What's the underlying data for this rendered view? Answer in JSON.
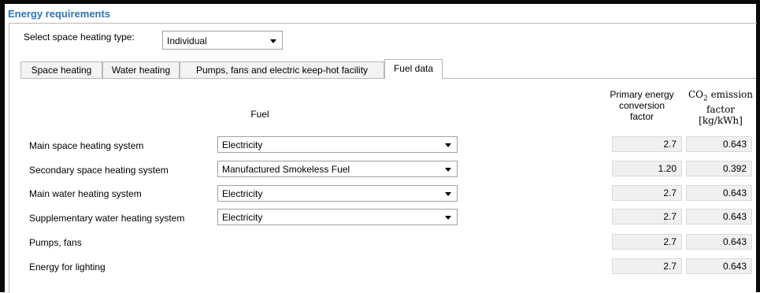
{
  "section_title": "Energy requirements",
  "heating_type": {
    "label": "Select space heating type:",
    "value": "Individual"
  },
  "tabs": [
    {
      "label": "Space heating",
      "active": false
    },
    {
      "label": "Water heating",
      "active": false
    },
    {
      "label": "Pumps, fans and electric keep-hot facility",
      "active": false
    },
    {
      "label": "Fuel data",
      "active": true
    }
  ],
  "table": {
    "fuel_header": "Fuel",
    "pef_header": [
      "Primary energy",
      "conversion",
      "factor"
    ],
    "co2_header": [
      "CO",
      "2",
      " emission",
      "factor",
      "[kg/kWh]"
    ],
    "rows": [
      {
        "label": "Main space heating system",
        "fuel": "Electricity",
        "pef": "2.7",
        "co2": "0.643"
      },
      {
        "label": "Secondary space heating system",
        "fuel": "Manufactured Smokeless Fuel",
        "pef": "1.20",
        "co2": "0.392"
      },
      {
        "label": "Main water heating system",
        "fuel": "Electricity",
        "pef": "2.7",
        "co2": "0.643"
      },
      {
        "label": "Supplementary water heating system",
        "fuel": "Electricity",
        "pef": "2.7",
        "co2": "0.643"
      },
      {
        "label": "Pumps, fans",
        "pef": "2.7",
        "co2": "0.643"
      },
      {
        "label": "Energy for lighting",
        "pef": "2.7",
        "co2": "0.643"
      }
    ]
  }
}
